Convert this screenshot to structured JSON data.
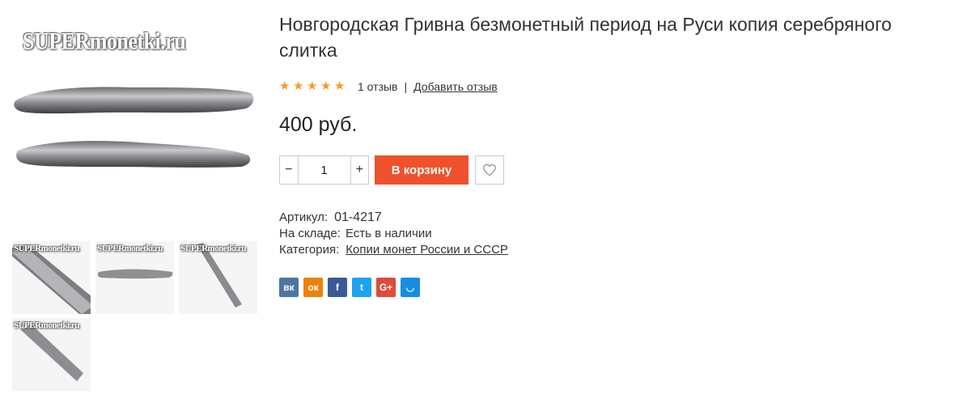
{
  "gallery": {
    "watermark": "SUPERmonetki.ru",
    "thumbnails": [
      {
        "watermark": "SUPERmonetki.ru"
      },
      {
        "watermark": "SUPERmonetki.ru"
      },
      {
        "watermark": "SUPERmonetki.ru"
      },
      {
        "watermark": "SUPERmonetki.ru"
      }
    ]
  },
  "product": {
    "title": "Новгородская Гривна безмонетный период на Руси копия серебряного слитка",
    "rating": {
      "stars": 5,
      "reviews_text": "1 отзыв",
      "separator": "|",
      "add_review_label": "Добавить отзыв"
    },
    "price": "400 руб.",
    "quantity": {
      "minus_label": "−",
      "value": "1",
      "plus_label": "+"
    },
    "add_to_cart_label": "В корзину",
    "wishlist_icon": "heart-icon",
    "details": {
      "sku_label": "Артикул:",
      "sku_value": "01-4217",
      "stock_label": "На складе:",
      "stock_value": "Есть в наличии",
      "category_label": "Категория:",
      "category_value": "Копии монет России и СССР"
    },
    "share": [
      {
        "name": "vk",
        "glyph": "вк",
        "color": "#4c75a3"
      },
      {
        "name": "odnoklassniki",
        "glyph": "ок",
        "color": "#ee8208"
      },
      {
        "name": "facebook",
        "glyph": "f",
        "color": "#3b5998"
      },
      {
        "name": "twitter",
        "glyph": "t",
        "color": "#1da1f2"
      },
      {
        "name": "google-plus",
        "glyph": "G+",
        "color": "#dd4b39"
      },
      {
        "name": "moimir",
        "glyph": "◡",
        "color": "#168de2"
      }
    ]
  }
}
